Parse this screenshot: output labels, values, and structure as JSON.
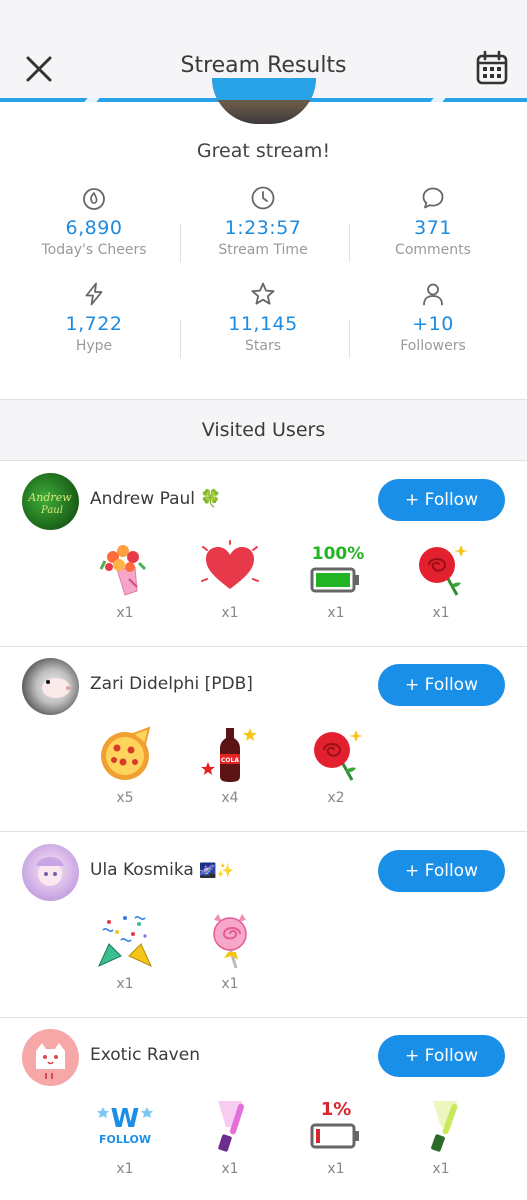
{
  "header": {
    "title": "Stream Results"
  },
  "summary": {
    "message": "Great stream!"
  },
  "stats": [
    {
      "icon": "cheers-icon",
      "value": "6,890",
      "label": "Today's Cheers"
    },
    {
      "icon": "clock-icon",
      "value": "1:23:57",
      "label": "Stream Time"
    },
    {
      "icon": "comment-icon",
      "value": "371",
      "label": "Comments"
    },
    {
      "icon": "lightning-icon",
      "value": "1,722",
      "label": "Hype"
    },
    {
      "icon": "star-icon",
      "value": "11,145",
      "label": "Stars"
    },
    {
      "icon": "person-icon",
      "value": "+10",
      "label": "Followers"
    }
  ],
  "visited": {
    "title": "Visited Users",
    "users": [
      {
        "name": "Andrew Paul",
        "badge": "🍀",
        "follow": "+ Follow",
        "gifts": [
          {
            "icon": "bouquet-icon",
            "count": "x1"
          },
          {
            "icon": "heart-icon",
            "count": "x1"
          },
          {
            "icon": "battery-full-icon",
            "count": "x1"
          },
          {
            "icon": "rose-icon",
            "count": "x1"
          }
        ]
      },
      {
        "name": "Zari Didelphi [PDB]",
        "badge": "",
        "follow": "+ Follow",
        "gifts": [
          {
            "icon": "pizza-icon",
            "count": "x5"
          },
          {
            "icon": "cola-icon",
            "count": "x4"
          },
          {
            "icon": "rose-icon",
            "count": "x2"
          }
        ]
      },
      {
        "name": "Ula Kosmika",
        "badge": "🌌✨",
        "follow": "+ Follow",
        "gifts": [
          {
            "icon": "confetti-icon",
            "count": "x1"
          },
          {
            "icon": "lollipop-icon",
            "count": "x1"
          }
        ]
      },
      {
        "name": "Exotic Raven",
        "badge": "",
        "follow": "+ Follow",
        "gifts": [
          {
            "icon": "w-follow-icon",
            "count": "x1"
          },
          {
            "icon": "glowstick-pink-icon",
            "count": "x1"
          },
          {
            "icon": "battery-low-icon",
            "count": "x1"
          },
          {
            "icon": "glowstick-green-icon",
            "count": "x1"
          }
        ]
      }
    ]
  },
  "labels": {
    "battery_full": "100%",
    "battery_low": "1%",
    "w_follow": "FOLLOW",
    "w_letter": "W",
    "cola": "COLA"
  },
  "colors": {
    "accent": "#1a8fe8",
    "header_line": "#29a3e8",
    "value_blue": "#1d8ce0",
    "muted": "#9a9a9a"
  }
}
